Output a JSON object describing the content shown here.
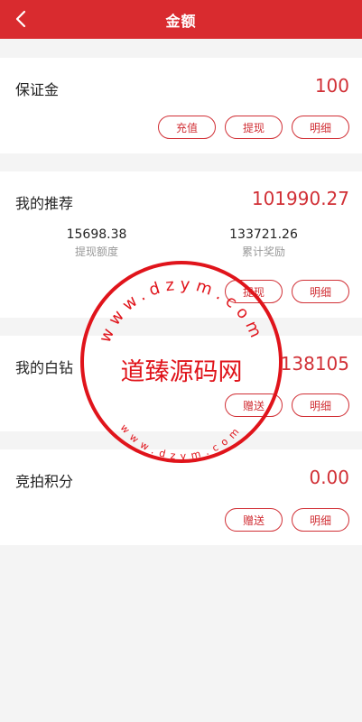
{
  "header": {
    "title": "金额"
  },
  "deposit": {
    "label": "保证金",
    "amount": "100",
    "buttons": [
      "充值",
      "提现",
      "明细"
    ]
  },
  "referral": {
    "label": "我的推荐",
    "amount": "101990.27",
    "stats": [
      {
        "value": "15698.38",
        "label": "提现额度"
      },
      {
        "value": "133721.26",
        "label": "累计奖励"
      }
    ],
    "buttons": [
      "提现",
      "明细"
    ]
  },
  "diamond": {
    "label": "我的白钻",
    "amount": "138105",
    "buttons": [
      "赠送",
      "明细"
    ]
  },
  "auction": {
    "label": "竞拍积分",
    "amount": "0.00",
    "buttons": [
      "赠送",
      "明细"
    ]
  },
  "watermark": {
    "main": "道臻源码网",
    "url_top": "www.dzym.com",
    "url_bottom": "www.dzym.com",
    "color": "#e0141b"
  },
  "colors": {
    "accent": "#d92b2f",
    "text_red": "#d13036"
  }
}
